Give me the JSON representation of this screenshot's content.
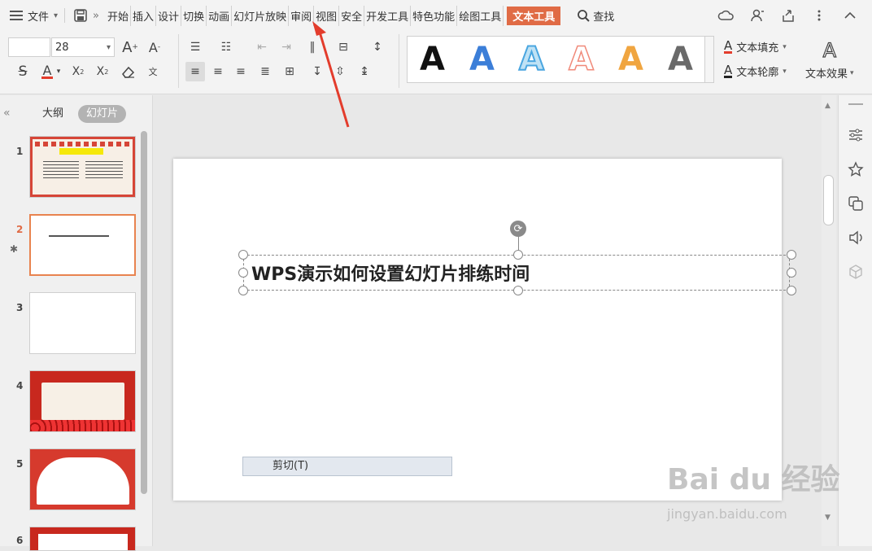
{
  "menu": {
    "file_label": "文件",
    "tabs": [
      "开始",
      "插入",
      "设计",
      "切换",
      "动画",
      "幻灯片放映",
      "审阅",
      "视图",
      "安全",
      "开发工具",
      "特色功能",
      "绘图工具"
    ],
    "active_tab": "文本工具",
    "search_label": "查找"
  },
  "ribbon": {
    "font_size": "28",
    "text_fill_label": "文本填充",
    "text_outline_label": "文本轮廓",
    "text_effect_label": "文本效果",
    "style_glyph": "A",
    "style_colors": [
      "#111111",
      "#3b7ed8",
      "#4aa6e0",
      "#f08a7a",
      "#f0a540",
      "#6a6a6a"
    ]
  },
  "panel": {
    "tab_outline": "大纲",
    "tab_slides": "幻灯片",
    "slide_numbers": [
      "1",
      "2",
      "3",
      "4",
      "5",
      "6"
    ],
    "current_slide": "2"
  },
  "slide": {
    "title": "WPS演示如何设置幻灯片排练时间"
  },
  "context_menu": {
    "cut_label": "剪切(T)"
  },
  "watermark": {
    "logo": "Bai du 经验",
    "url": "jingyan.baidu.com"
  },
  "colors": {
    "accent": "#e06b45",
    "arrow": "#e33c2c"
  }
}
